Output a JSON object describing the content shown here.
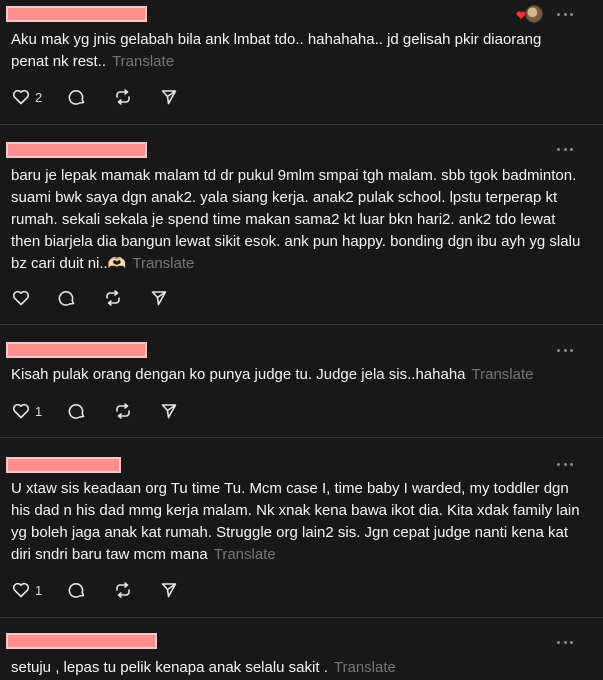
{
  "posts": [
    {
      "text": "Aku mak yg jnis gelabah bila ank lmbat tdo.. hahahaha.. jd gelisah pkir diaorang penat nk rest..",
      "translate": "Translate",
      "likes": "2"
    },
    {
      "text": "baru je lepak mamak malam td dr pukul 9mlm smpai tgh malam. sbb tgok badminton. suami bwk saya dgn anak2. yala siang kerja. anak2 pulak school. lpstu terperap kt rumah. sekali sekala je spend time makan sama2 kt luar bkn hari2. ank2 tdo lewat then biarjela dia bangun lewat sikit esok. ank pun happy. bonding dgn ibu ayh yg slalu bz cari duit ni..🫶🏻",
      "translate": "Translate",
      "likes": ""
    },
    {
      "text": "Kisah pulak orang dengan ko punya judge tu. Judge jela sis..hahaha",
      "translate": "Translate",
      "likes": "1"
    },
    {
      "text": "U xtaw sis keadaan org Tu time Tu. Mcm case I, time baby I warded, my toddler dgn his dad n his dad mmg kerja malam. Nk xnak kena bawa ikot dia. Kita xdak family lain yg boleh jaga anak kat rumah. Struggle org lain2 sis. Jgn cepat judge nanti kena kat diri sndri baru taw mcm mana",
      "translate": "Translate",
      "likes": "1"
    },
    {
      "text": "setuju , lepas tu pelik kenapa anak selalu sakit .",
      "translate": "Translate",
      "likes": ""
    }
  ],
  "colors": {
    "background": "#181818",
    "text": "#f3f5f7",
    "muted": "#777777",
    "redaction": "#ff8f8f",
    "divider": "#333638"
  },
  "icons": [
    "heart-icon",
    "comment-icon",
    "repost-icon",
    "share-icon",
    "more-icon"
  ]
}
